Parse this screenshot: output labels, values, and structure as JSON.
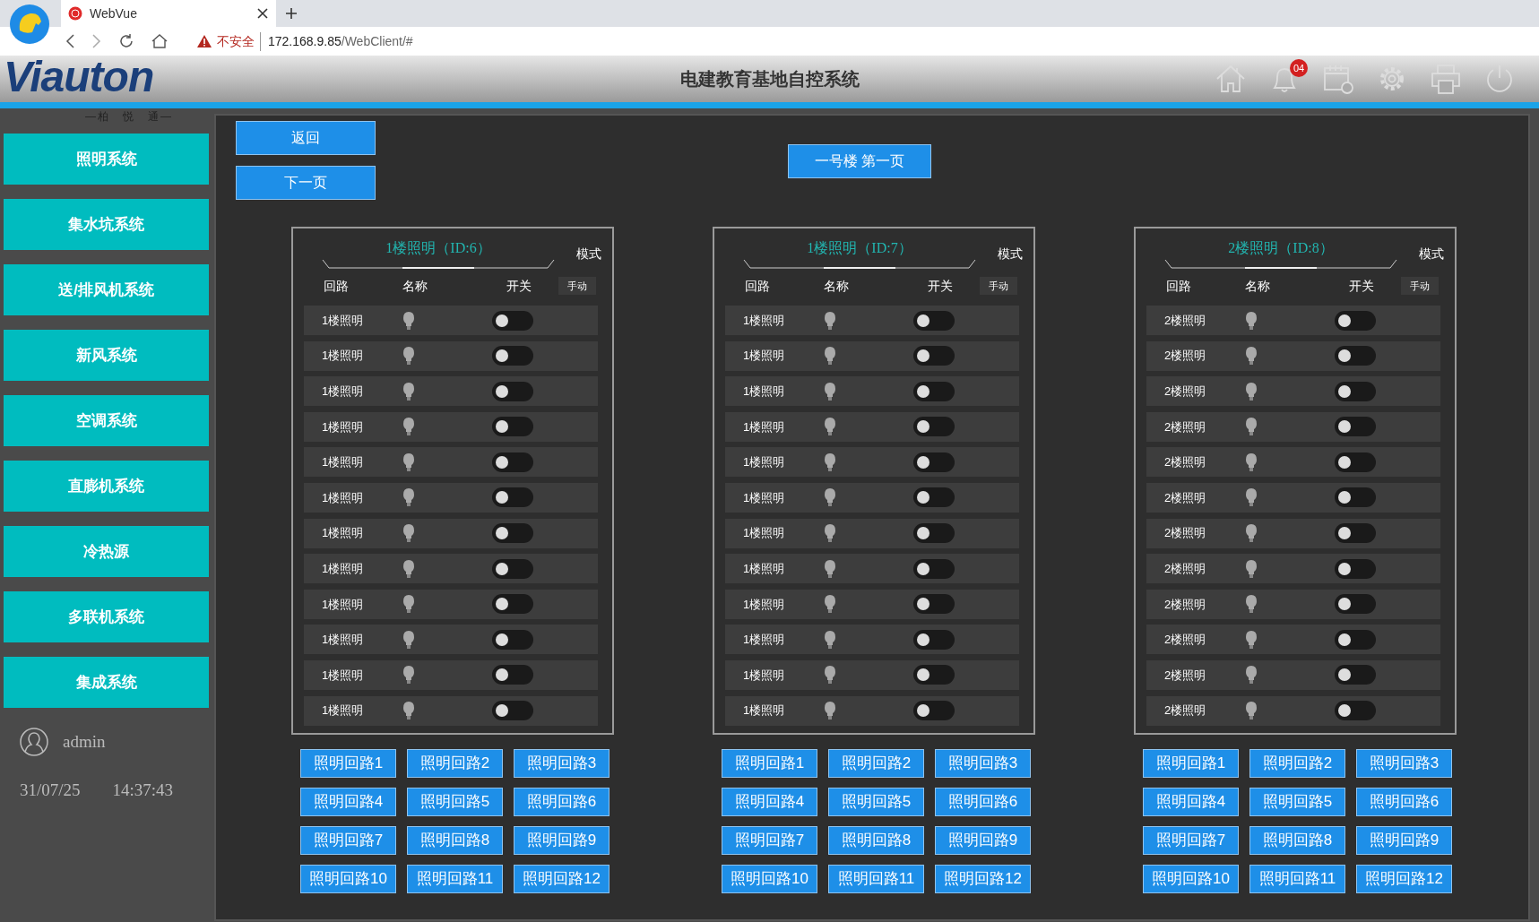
{
  "browser": {
    "tab_title": "WebVue",
    "security": "不安全",
    "url_host": "172.168.9.85",
    "url_path": "/WebClient/#"
  },
  "header": {
    "logo": "Viauton",
    "logo_subtitle": "—柏　悦　通—",
    "title": "电建教育基地自控系统",
    "notification_count": "04"
  },
  "sidebar": {
    "items": [
      {
        "label": "照明系统"
      },
      {
        "label": "集水坑系统"
      },
      {
        "label": "送/排风机系统"
      },
      {
        "label": "新风系统"
      },
      {
        "label": "空调系统"
      },
      {
        "label": "直膨机系统"
      },
      {
        "label": "冷热源"
      },
      {
        "label": "多联机系统"
      },
      {
        "label": "集成系统"
      }
    ],
    "user": "admin",
    "date": "31/07/25",
    "time": "14:37:43"
  },
  "nav_buttons": [
    "返回",
    "下一页"
  ],
  "page_title": "一号楼 第一页",
  "panels": [
    {
      "title": "1楼照明（ID:6）",
      "mode_label": "模式",
      "columns": [
        "回路",
        "名称",
        "开关"
      ],
      "mode": "手动",
      "circuits": [
        {
          "label": "1楼照明",
          "on": false
        },
        {
          "label": "1楼照明",
          "on": false
        },
        {
          "label": "1楼照明",
          "on": false
        },
        {
          "label": "1楼照明",
          "on": false
        },
        {
          "label": "1楼照明",
          "on": false
        },
        {
          "label": "1楼照明",
          "on": false
        },
        {
          "label": "1楼照明",
          "on": false
        },
        {
          "label": "1楼照明",
          "on": false
        },
        {
          "label": "1楼照明",
          "on": false
        },
        {
          "label": "1楼照明",
          "on": false
        },
        {
          "label": "1楼照明",
          "on": false
        },
        {
          "label": "1楼照明",
          "on": false
        }
      ],
      "loop_buttons": [
        "照明回路1",
        "照明回路2",
        "照明回路3",
        "照明回路4",
        "照明回路5",
        "照明回路6",
        "照明回路7",
        "照明回路8",
        "照明回路9",
        "照明回路10",
        "照明回路11",
        "照明回路12"
      ]
    },
    {
      "title": "1楼照明（ID:7）",
      "mode_label": "模式",
      "columns": [
        "回路",
        "名称",
        "开关"
      ],
      "mode": "手动",
      "circuits": [
        {
          "label": "1楼照明",
          "on": false
        },
        {
          "label": "1楼照明",
          "on": false
        },
        {
          "label": "1楼照明",
          "on": false
        },
        {
          "label": "1楼照明",
          "on": false
        },
        {
          "label": "1楼照明",
          "on": false
        },
        {
          "label": "1楼照明",
          "on": false
        },
        {
          "label": "1楼照明",
          "on": false
        },
        {
          "label": "1楼照明",
          "on": false
        },
        {
          "label": "1楼照明",
          "on": false
        },
        {
          "label": "1楼照明",
          "on": false
        },
        {
          "label": "1楼照明",
          "on": false
        },
        {
          "label": "1楼照明",
          "on": false
        }
      ],
      "loop_buttons": [
        "照明回路1",
        "照明回路2",
        "照明回路3",
        "照明回路4",
        "照明回路5",
        "照明回路6",
        "照明回路7",
        "照明回路8",
        "照明回路9",
        "照明回路10",
        "照明回路11",
        "照明回路12"
      ]
    },
    {
      "title": "2楼照明（ID:8）",
      "mode_label": "模式",
      "columns": [
        "回路",
        "名称",
        "开关"
      ],
      "mode": "手动",
      "circuits": [
        {
          "label": "2楼照明",
          "on": false
        },
        {
          "label": "2楼照明",
          "on": false
        },
        {
          "label": "2楼照明",
          "on": false
        },
        {
          "label": "2楼照明",
          "on": false
        },
        {
          "label": "2楼照明",
          "on": false
        },
        {
          "label": "2楼照明",
          "on": false
        },
        {
          "label": "2楼照明",
          "on": false
        },
        {
          "label": "2楼照明",
          "on": false
        },
        {
          "label": "2楼照明",
          "on": false
        },
        {
          "label": "2楼照明",
          "on": false
        },
        {
          "label": "2楼照明",
          "on": false
        },
        {
          "label": "2楼照明",
          "on": false
        }
      ],
      "loop_buttons": [
        "照明回路1",
        "照明回路2",
        "照明回路3",
        "照明回路4",
        "照明回路5",
        "照明回路6",
        "照明回路7",
        "照明回路8",
        "照明回路9",
        "照明回路10",
        "照明回路11",
        "照明回路12"
      ]
    }
  ]
}
